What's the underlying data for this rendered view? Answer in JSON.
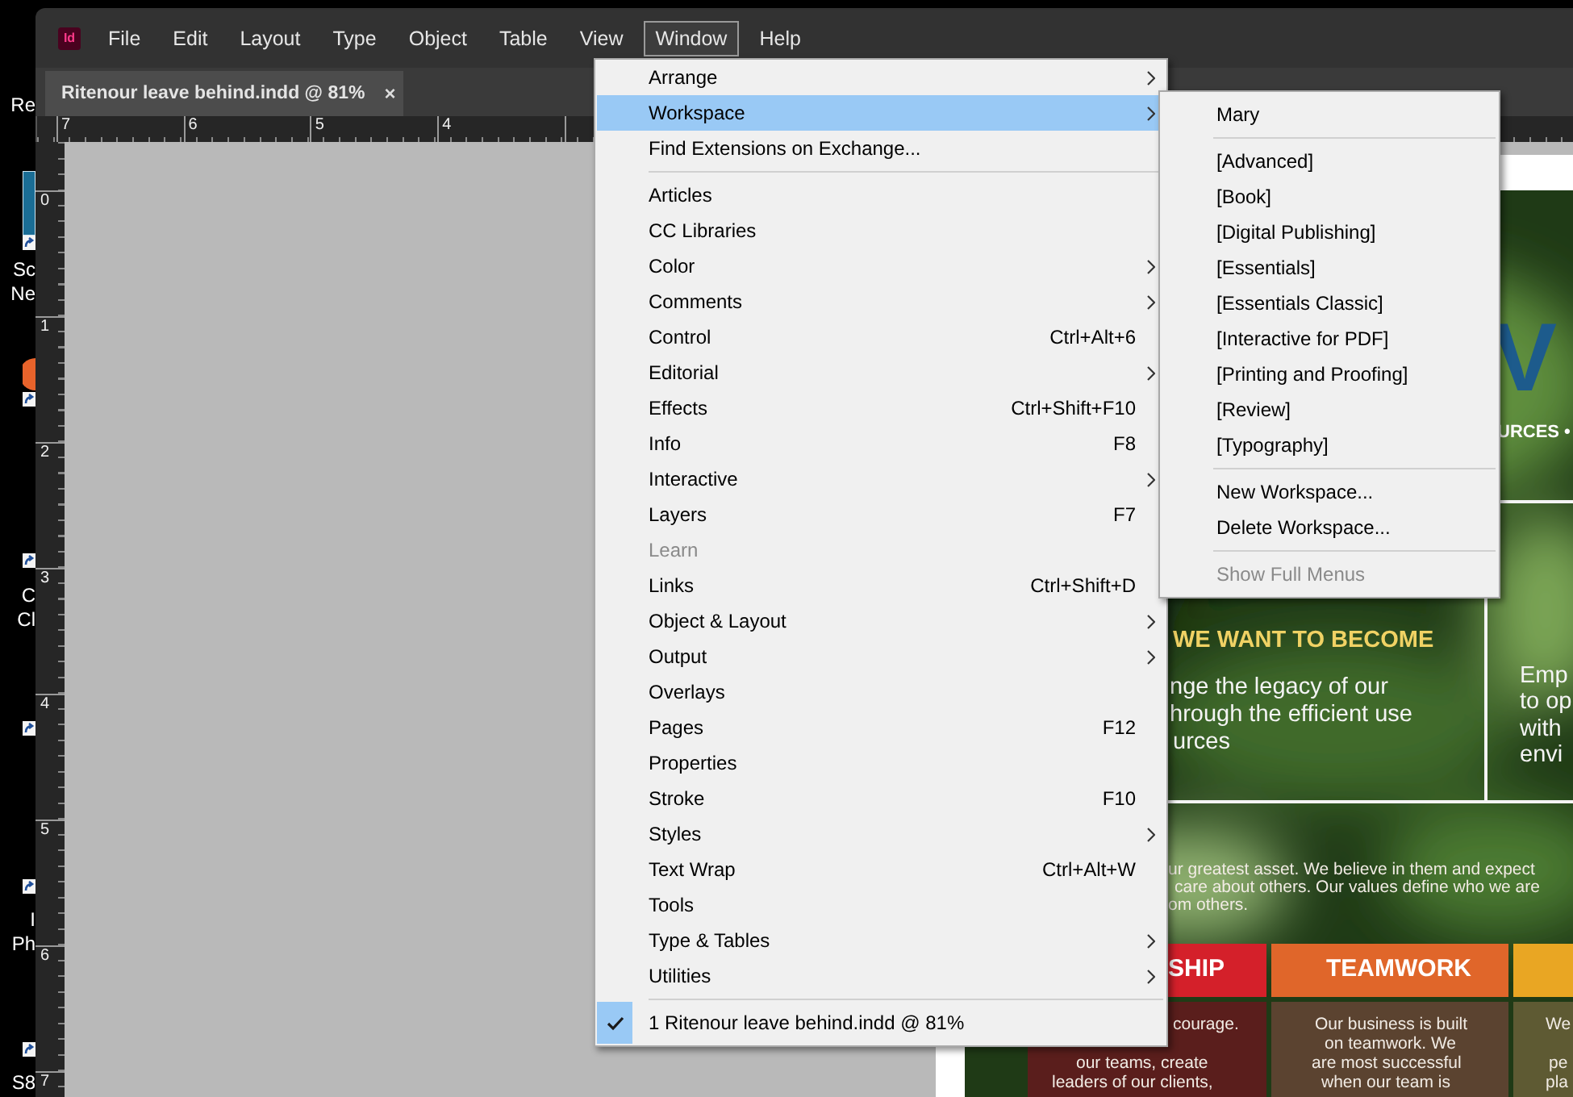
{
  "desktop": {
    "labels": [
      "Re",
      "Sc",
      "Ne",
      "C",
      "Cl",
      "I",
      "Ph",
      "S8"
    ]
  },
  "app": {
    "logo": "Id",
    "menu": [
      {
        "label": "File",
        "selected": false
      },
      {
        "label": "Edit",
        "selected": false
      },
      {
        "label": "Layout",
        "selected": false
      },
      {
        "label": "Type",
        "selected": false
      },
      {
        "label": "Object",
        "selected": false
      },
      {
        "label": "Table",
        "selected": false
      },
      {
        "label": "View",
        "selected": false
      },
      {
        "label": "Window",
        "selected": true
      },
      {
        "label": "Help",
        "selected": false
      }
    ]
  },
  "document_tab": {
    "title": "Ritenour leave behind.indd @ 81%",
    "close": "×"
  },
  "rulers": {
    "horizontal": [
      "7",
      "6",
      "5",
      "4"
    ],
    "vertical": [
      "0",
      "1",
      "2",
      "3",
      "4",
      "5",
      "6",
      "7"
    ]
  },
  "document": {
    "texts": [
      {
        "kind": "logo",
        "text": "V"
      },
      {
        "kind": "caption",
        "text": "URCES •"
      },
      {
        "kind": "heading",
        "text": "WE WANT TO BECOME"
      },
      {
        "kind": "body",
        "text": "nge the legacy of our"
      },
      {
        "kind": "body",
        "text": "hrough the efficient use"
      },
      {
        "kind": "body",
        "text": "urces"
      },
      {
        "kind": "body",
        "text": "Emp"
      },
      {
        "kind": "body",
        "text": "to op"
      },
      {
        "kind": "body",
        "text": "with"
      },
      {
        "kind": "body",
        "text": "envi"
      },
      {
        "kind": "small",
        "text": "ur greatest asset. We believe in them and expect"
      },
      {
        "kind": "small",
        "text": "care about others. Our values define who we are"
      },
      {
        "kind": "small",
        "text": "om others."
      },
      {
        "kind": "band-title",
        "text": "SHIP"
      },
      {
        "kind": "band-title",
        "text": "TEAMWORK"
      },
      {
        "kind": "small",
        "text": "courage."
      },
      {
        "kind": "small",
        "text": "our teams, create"
      },
      {
        "kind": "small",
        "text": "leaders of our clients,"
      },
      {
        "kind": "small",
        "text": "Our business is built"
      },
      {
        "kind": "small",
        "text": "on teamwork. We"
      },
      {
        "kind": "small",
        "text": "are most successful"
      },
      {
        "kind": "small",
        "text": "when our team is"
      },
      {
        "kind": "small",
        "text": "We"
      },
      {
        "kind": "small",
        "text": "pe"
      },
      {
        "kind": "small",
        "text": "pla"
      }
    ],
    "bands": [
      {
        "color": "#d4202a"
      },
      {
        "color": "#e0662a"
      },
      {
        "color": "#e9a623"
      }
    ],
    "panels": [
      {
        "color": "#5a1e1c"
      },
      {
        "color": "#5b4330"
      },
      {
        "color": "#5e5a33"
      }
    ]
  },
  "window_menu": {
    "items": [
      {
        "kind": "item",
        "label": "Arrange",
        "submenu": true,
        "disabled": false,
        "selected": false,
        "checked": false
      },
      {
        "kind": "item",
        "label": "Workspace",
        "submenu": true,
        "disabled": false,
        "selected": true,
        "checked": false
      },
      {
        "kind": "item",
        "label": "Find Extensions on Exchange...",
        "submenu": false,
        "disabled": false,
        "selected": false,
        "checked": false
      },
      {
        "kind": "separator"
      },
      {
        "kind": "item",
        "label": "Articles",
        "submenu": false,
        "disabled": false,
        "selected": false,
        "checked": false
      },
      {
        "kind": "item",
        "label": "CC Libraries",
        "submenu": false,
        "disabled": false,
        "selected": false,
        "checked": false
      },
      {
        "kind": "item",
        "label": "Color",
        "submenu": true,
        "disabled": false,
        "selected": false,
        "checked": false
      },
      {
        "kind": "item",
        "label": "Comments",
        "submenu": true,
        "disabled": false,
        "selected": false,
        "checked": false
      },
      {
        "kind": "item",
        "label": "Control",
        "shortcut": "Ctrl+Alt+6",
        "submenu": false,
        "disabled": false,
        "selected": false,
        "checked": false
      },
      {
        "kind": "item",
        "label": "Editorial",
        "submenu": true,
        "disabled": false,
        "selected": false,
        "checked": false
      },
      {
        "kind": "item",
        "label": "Effects",
        "shortcut": "Ctrl+Shift+F10",
        "submenu": false,
        "disabled": false,
        "selected": false,
        "checked": false
      },
      {
        "kind": "item",
        "label": "Info",
        "shortcut": "F8",
        "submenu": false,
        "disabled": false,
        "selected": false,
        "checked": false
      },
      {
        "kind": "item",
        "label": "Interactive",
        "submenu": true,
        "disabled": false,
        "selected": false,
        "checked": false
      },
      {
        "kind": "item",
        "label": "Layers",
        "shortcut": "F7",
        "submenu": false,
        "disabled": false,
        "selected": false,
        "checked": false
      },
      {
        "kind": "item",
        "label": "Learn",
        "submenu": false,
        "disabled": true,
        "selected": false,
        "checked": false
      },
      {
        "kind": "item",
        "label": "Links",
        "shortcut": "Ctrl+Shift+D",
        "submenu": false,
        "disabled": false,
        "selected": false,
        "checked": false
      },
      {
        "kind": "item",
        "label": "Object & Layout",
        "submenu": true,
        "disabled": false,
        "selected": false,
        "checked": false
      },
      {
        "kind": "item",
        "label": "Output",
        "submenu": true,
        "disabled": false,
        "selected": false,
        "checked": false
      },
      {
        "kind": "item",
        "label": "Overlays",
        "submenu": false,
        "disabled": false,
        "selected": false,
        "checked": false
      },
      {
        "kind": "item",
        "label": "Pages",
        "shortcut": "F12",
        "submenu": false,
        "disabled": false,
        "selected": false,
        "checked": false
      },
      {
        "kind": "item",
        "label": "Properties",
        "submenu": false,
        "disabled": false,
        "selected": false,
        "checked": false
      },
      {
        "kind": "item",
        "label": "Stroke",
        "shortcut": "F10",
        "submenu": false,
        "disabled": false,
        "selected": false,
        "checked": false
      },
      {
        "kind": "item",
        "label": "Styles",
        "submenu": true,
        "disabled": false,
        "selected": false,
        "checked": false
      },
      {
        "kind": "item",
        "label": "Text Wrap",
        "shortcut": "Ctrl+Alt+W",
        "submenu": false,
        "disabled": false,
        "selected": false,
        "checked": false
      },
      {
        "kind": "item",
        "label": "Tools",
        "submenu": false,
        "disabled": false,
        "selected": false,
        "checked": false
      },
      {
        "kind": "item",
        "label": "Type & Tables",
        "submenu": true,
        "disabled": false,
        "selected": false,
        "checked": false
      },
      {
        "kind": "item",
        "label": "Utilities",
        "submenu": true,
        "disabled": false,
        "selected": false,
        "checked": false
      },
      {
        "kind": "separator"
      },
      {
        "kind": "item",
        "label": "1 Ritenour leave behind.indd @ 81%",
        "submenu": false,
        "disabled": false,
        "selected": false,
        "checked": true
      }
    ]
  },
  "workspace_submenu": {
    "items": [
      {
        "kind": "item",
        "label": "Mary",
        "submenu": false,
        "disabled": false,
        "selected": false,
        "checked": false
      },
      {
        "kind": "separator"
      },
      {
        "kind": "item",
        "label": "[Advanced]",
        "submenu": false,
        "disabled": false,
        "selected": false,
        "checked": false
      },
      {
        "kind": "item",
        "label": "[Book]",
        "submenu": false,
        "disabled": false,
        "selected": false,
        "checked": false
      },
      {
        "kind": "item",
        "label": "[Digital Publishing]",
        "submenu": false,
        "disabled": false,
        "selected": false,
        "checked": false
      },
      {
        "kind": "item",
        "label": "[Essentials]",
        "submenu": false,
        "disabled": false,
        "selected": false,
        "checked": false
      },
      {
        "kind": "item",
        "label": "[Essentials Classic]",
        "submenu": false,
        "disabled": false,
        "selected": false,
        "checked": false
      },
      {
        "kind": "item",
        "label": "[Interactive for PDF]",
        "submenu": false,
        "disabled": false,
        "selected": false,
        "checked": false
      },
      {
        "kind": "item",
        "label": "[Printing and Proofing]",
        "submenu": false,
        "disabled": false,
        "selected": false,
        "checked": false
      },
      {
        "kind": "item",
        "label": "[Review]",
        "submenu": false,
        "disabled": false,
        "selected": false,
        "checked": false
      },
      {
        "kind": "item",
        "label": "[Typography]",
        "submenu": false,
        "disabled": false,
        "selected": false,
        "checked": false
      },
      {
        "kind": "separator"
      },
      {
        "kind": "item",
        "label": "New Workspace...",
        "submenu": false,
        "disabled": false,
        "selected": false,
        "checked": false
      },
      {
        "kind": "item",
        "label": "Delete Workspace...",
        "submenu": false,
        "disabled": false,
        "selected": false,
        "checked": false
      },
      {
        "kind": "separator"
      },
      {
        "kind": "item",
        "label": "Show Full Menus",
        "submenu": false,
        "disabled": true,
        "selected": false,
        "checked": false
      }
    ]
  }
}
